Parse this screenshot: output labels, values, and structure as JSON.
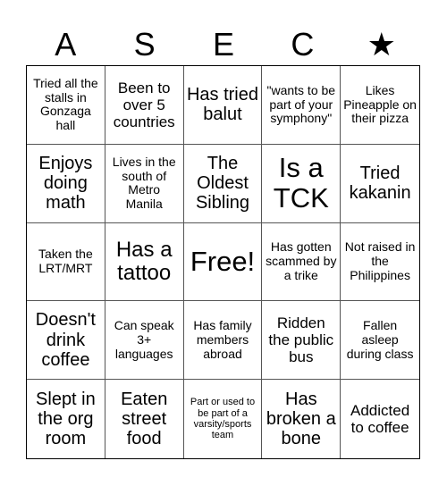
{
  "header": {
    "letters": [
      "A",
      "S",
      "E",
      "C",
      "★"
    ],
    "icons": [
      "letter-a",
      "letter-s",
      "letter-e",
      "letter-c",
      "star-icon"
    ]
  },
  "board": {
    "cells": [
      "Tried all the stalls in Gonzaga hall",
      "Been to over 5 countries",
      "Has tried balut",
      "\"wants to be part of your symphony\"",
      "Likes Pineapple on their pizza",
      "Enjoys doing math",
      "Lives in the south of Metro Manila",
      "The Oldest Sibling",
      "Is a TCK",
      "Tried kakanin",
      "Taken the LRT/MRT",
      "Has a tattoo",
      "Free!",
      "Has gotten scammed by a trike",
      "Not raised in the Philippines",
      "Doesn't drink coffee",
      "Can speak 3+ languages",
      "Has family members abroad",
      "Ridden the public bus",
      "Fallen asleep during class",
      "Slept in the org room",
      "Eaten street food",
      "Part or used to be part of a varsity/sports team",
      "Has broken a bone",
      "Addicted to coffee"
    ]
  }
}
